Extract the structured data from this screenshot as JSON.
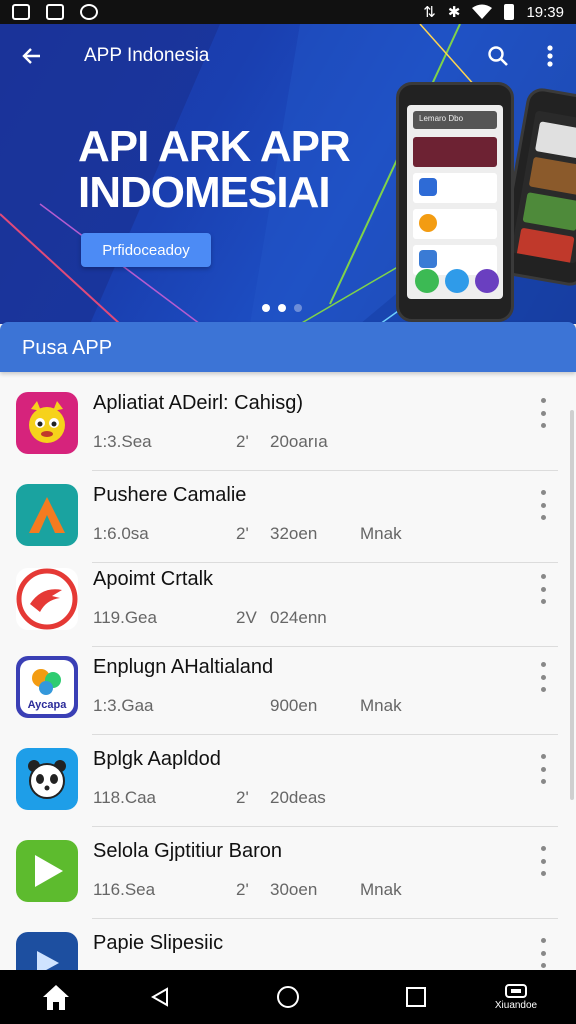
{
  "status_bar": {
    "time": "19:39",
    "left_icons": [
      "gallery-icon",
      "image-icon",
      "messenger-icon"
    ],
    "right_icons": [
      "signal-icon",
      "bluetooth-icon",
      "wifi-icon",
      "battery-icon"
    ]
  },
  "toolbar": {
    "title": "APP Indonesia",
    "back_icon": "back-arrow-icon",
    "search_icon": "search-icon",
    "more_icon": "more-vert-icon"
  },
  "hero": {
    "headline_line1": "API ARK APR",
    "headline_line2": "INDOMESIAI",
    "cta_label": "Prfidoceadoy",
    "phone_search_text": "Lemaro Dbo",
    "page_indicator": {
      "count": 3,
      "active": 1
    }
  },
  "section": {
    "title": "Pusa APP"
  },
  "apps": [
    {
      "name": "Apliatiat ADeirl: Cahisg)",
      "meta1": "1:3.Sea",
      "meta2": "2'",
      "meta3": "20oarıa",
      "meta4": "",
      "icon": "cat-mascot-icon",
      "icon_color": "#d6237c"
    },
    {
      "name": "Pushere Camalie",
      "meta1": "1:6.0sa",
      "meta2": "2'",
      "meta3": "32oen",
      "meta4": "Mnak",
      "icon": "triangle-a-icon",
      "icon_color": "#1aa3a0"
    },
    {
      "name": "Apoimt Crtalk",
      "meta1": "119.Gea",
      "meta2": "2V",
      "meta3": "024enn",
      "meta4": "",
      "icon": "red-arrow-circle-icon",
      "icon_color": "#e53935"
    },
    {
      "name": "Enplugn AHaltialand",
      "meta1": "1:3.Gaa",
      "meta2": "",
      "meta3": "900en",
      "meta4": "Mnak",
      "icon": "aycapa-logo-icon",
      "icon_color": "#3a3fb5"
    },
    {
      "name": "Bplgk Aapldod",
      "meta1": "118.Caa",
      "meta2": "2'",
      "meta3": "20deas",
      "meta4": "",
      "icon": "panda-icon",
      "icon_color": "#1e9ee8"
    },
    {
      "name": "Selola Gjptitiur Baron",
      "meta1": "116.Sea",
      "meta2": "2'",
      "meta3": "30oen",
      "meta4": "Mnak",
      "icon": "play-triangle-icon",
      "icon_color": "#5dbb2e"
    },
    {
      "name": "Papie Slipesiic",
      "meta1": "",
      "meta2": "",
      "meta3": "",
      "meta4": "",
      "icon": "blue-play-icon",
      "icon_color": "#1d4fa0"
    }
  ],
  "nav_bar": {
    "home_icon": "home-icon",
    "back_icon": "back-triangle-icon",
    "home_circle_icon": "home-circle-icon",
    "recents_icon": "recents-square-icon",
    "extra_icon": "cast-icon",
    "extra_label": "Xiuandoe"
  }
}
